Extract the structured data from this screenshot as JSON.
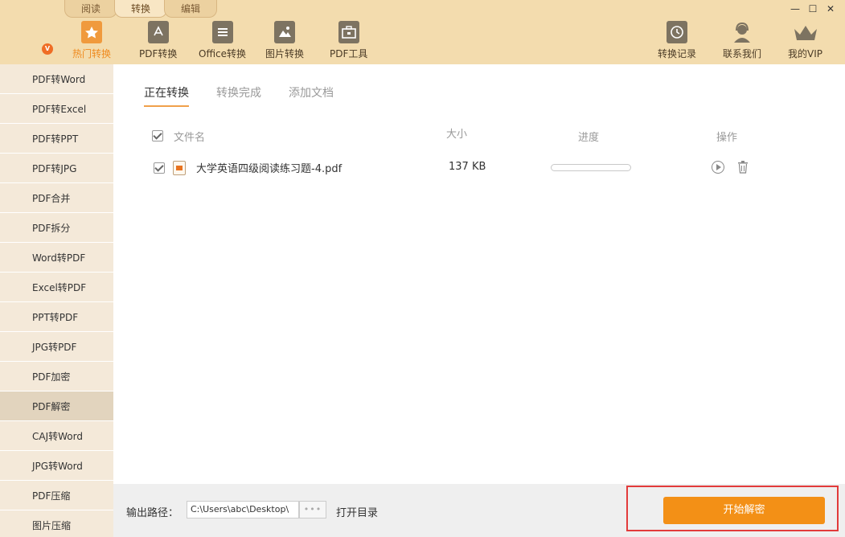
{
  "top_tabs": [
    "阅读",
    "转换",
    "编辑"
  ],
  "active_top_tab": 1,
  "window_controls": {
    "minimize": "—",
    "maximize": "☐",
    "close": "✕"
  },
  "nav": {
    "hot_badge": "V",
    "items": [
      {
        "label": "热门转换",
        "icon": "star-icon"
      },
      {
        "label": "PDF转换",
        "icon": "pdf-icon"
      },
      {
        "label": "Office转换",
        "icon": "document-icon"
      },
      {
        "label": "图片转换",
        "icon": "image-icon"
      },
      {
        "label": "PDF工具",
        "icon": "toolbox-icon"
      }
    ],
    "right_items": [
      {
        "label": "转换记录",
        "icon": "clock-icon"
      },
      {
        "label": "联系我们",
        "icon": "headset-icon"
      },
      {
        "label": "我的VIP",
        "icon": "crown-icon"
      }
    ]
  },
  "sidebar": {
    "active_index": 11,
    "items": [
      "PDF转Word",
      "PDF转Excel",
      "PDF转PPT",
      "PDF转JPG",
      "PDF合并",
      "PDF拆分",
      "Word转PDF",
      "Excel转PDF",
      "PPT转PDF",
      "JPG转PDF",
      "PDF加密",
      "PDF解密",
      "CAJ转Word",
      "JPG转Word",
      "PDF压缩",
      "图片压缩"
    ]
  },
  "subtabs": [
    "正在转换",
    "转换完成",
    "添加文档"
  ],
  "table": {
    "headers": {
      "name": "文件名",
      "size": "大小",
      "progress": "进度",
      "ops": "操作"
    },
    "rows": [
      {
        "name": "大学英语四级阅读练习题-4.pdf",
        "size": "137 KB",
        "progress": 0
      }
    ]
  },
  "bottom": {
    "output_label": "输出路径：",
    "output_path": "C:\\Users\\abc\\Desktop\\",
    "browse": "•••",
    "open_dir": "打开目录",
    "start_button": "开始解密"
  },
  "colors": {
    "accent": "#f39016",
    "header_bg": "#f3dcae",
    "highlight": "#e23b3b"
  }
}
